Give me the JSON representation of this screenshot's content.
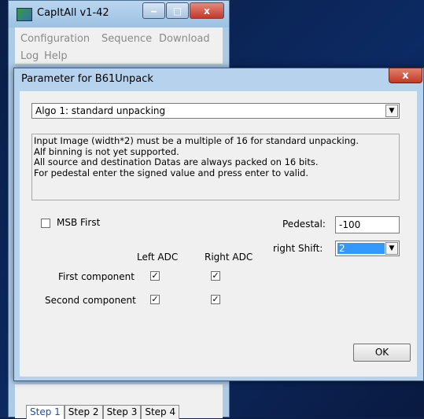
{
  "app": {
    "title": "CapItAll v1-42",
    "menu": [
      "Configuration",
      "Sequence",
      "Download",
      "Log",
      "Help"
    ],
    "tabs": [
      "Step 1",
      "Step 2",
      "Step 3",
      "Step 4"
    ],
    "active_tab": "Step 1"
  },
  "dialog": {
    "title": "Parameter for B61Unpack",
    "close_label": "x",
    "algo": {
      "selected": "Algo 1: standard unpacking",
      "arrow": "▼"
    },
    "info_lines": [
      "Input Image (width*2) must be a multiple of 16 for standard unpacking.",
      "Alf binning is not yet supported.",
      "All source and destination Datas are always packed on 16 bits.",
      "For pedestal enter the signed value and press enter to valid."
    ],
    "msb_first": {
      "label": "MSB First",
      "checked": false
    },
    "pedestal": {
      "label": "Pedestal:",
      "value": "-100"
    },
    "right_shift": {
      "label": "right Shift:",
      "value": "2",
      "arrow": "▼"
    },
    "headers": {
      "left_adc": "Left ADC",
      "right_adc": "Right ADC"
    },
    "rows": [
      {
        "label": "First component",
        "left": true,
        "right": true
      },
      {
        "label": "Second component",
        "left": true,
        "right": true
      }
    ],
    "ok_label": "OK"
  }
}
